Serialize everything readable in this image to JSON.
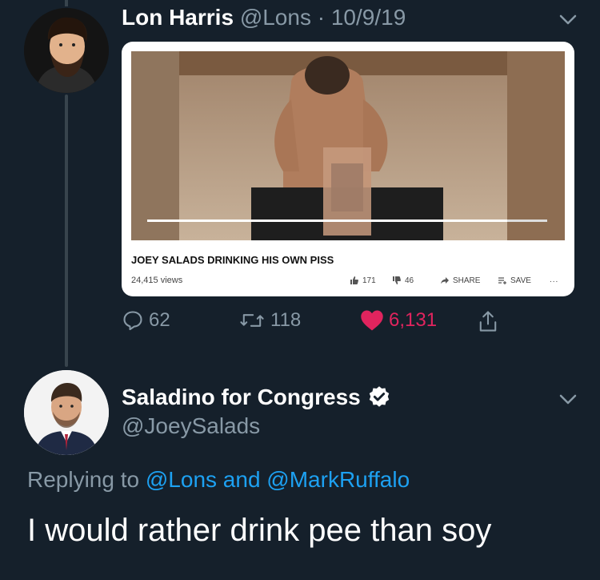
{
  "tweet1": {
    "name": "Lon Harris",
    "handle": "@Lons",
    "separator": " · ",
    "date": "10/9/19",
    "media": {
      "title": "JOEY SALADS DRINKING HIS OWN PISS",
      "views": "24,415 views",
      "likes": "171",
      "dislikes": "46",
      "share_label": "SHARE",
      "save_label": "SAVE",
      "more_label": "...",
      "progress": 0.9
    },
    "reply_count": "62",
    "retweet_count": "118",
    "like_count": "6,131"
  },
  "tweet2": {
    "name": "Saladino for Congress",
    "handle": "@JoeySalads",
    "replying_prefix": "Replying to ",
    "replying_user1": "@Lons",
    "replying_and": " and ",
    "replying_user2": "@MarkRuffalo",
    "text": "I would rather drink pee than soy"
  },
  "colors": {
    "background": "#15202b",
    "secondary_text": "#8899a6",
    "link": "#1da1f2",
    "like": "#e0245e",
    "thread_line": "#38444d"
  }
}
